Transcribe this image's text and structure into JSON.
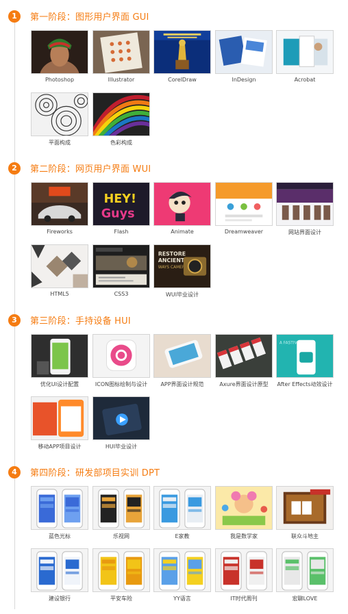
{
  "stages": [
    {
      "number": "1",
      "title": "第一阶段：图形用户界面 GUI",
      "items": [
        {
          "label": "Photoshop",
          "art": "portrait"
        },
        {
          "label": "Illustrator",
          "art": "icons"
        },
        {
          "label": "CorelDraw",
          "art": "trophy"
        },
        {
          "label": "InDesign",
          "art": "brochure"
        },
        {
          "label": "Acrobat",
          "art": "pages"
        },
        {
          "label": "平面构成",
          "art": "circles"
        },
        {
          "label": "色彩构成",
          "art": "rainbow"
        }
      ]
    },
    {
      "number": "2",
      "title": "第二阶段：网页用户界面 WUI",
      "items": [
        {
          "label": "Fireworks",
          "art": "car"
        },
        {
          "label": "Flash",
          "art": "heyguys"
        },
        {
          "label": "Animate",
          "art": "cartoon"
        },
        {
          "label": "Dreamweaver",
          "art": "webpage"
        },
        {
          "label": "网站界面设计",
          "art": "fashion"
        },
        {
          "label": "HTML5",
          "art": "diamonds"
        },
        {
          "label": "CSS3",
          "art": "blog"
        },
        {
          "label": "WUI毕业设计",
          "art": "camera"
        }
      ]
    },
    {
      "number": "3",
      "title": "第三阶段：手持设备 HUI",
      "items": [
        {
          "label": "优化UI设计配置",
          "art": "phone-dark"
        },
        {
          "label": "ICON图标绘制与设计",
          "art": "pink-icon"
        },
        {
          "label": "APP界面设计规范",
          "art": "phone-tilt"
        },
        {
          "label": "Axure界面设计原型",
          "art": "screens"
        },
        {
          "label": "After Effects动效设计",
          "art": "teal-app"
        },
        {
          "label": "移动APP项目设计",
          "art": "orange-app"
        },
        {
          "label": "HUI毕业设计",
          "art": "dark-phone"
        }
      ]
    },
    {
      "number": "4",
      "title": "第四阶段：研发部项目实训 DPT",
      "items": [
        {
          "label": "蓝色光标",
          "art": "two-phones-blue"
        },
        {
          "label": "乐视网",
          "art": "two-phones-dark"
        },
        {
          "label": "E家教",
          "art": "two-phones-map"
        },
        {
          "label": "我是数学家",
          "art": "kids-game"
        },
        {
          "label": "联众斗地主",
          "art": "card-game"
        },
        {
          "label": "建设银行",
          "art": "two-phones-bank"
        },
        {
          "label": "平安车险",
          "art": "two-phones-yellow"
        },
        {
          "label": "YY语言",
          "art": "two-phones-yy"
        },
        {
          "label": "IT时代周刊",
          "art": "two-phones-news"
        },
        {
          "label": "宏聊LOVE",
          "art": "two-phones-chat"
        }
      ]
    }
  ],
  "colors": {
    "accent": "#f57c12",
    "line": "#d8d8d8"
  }
}
